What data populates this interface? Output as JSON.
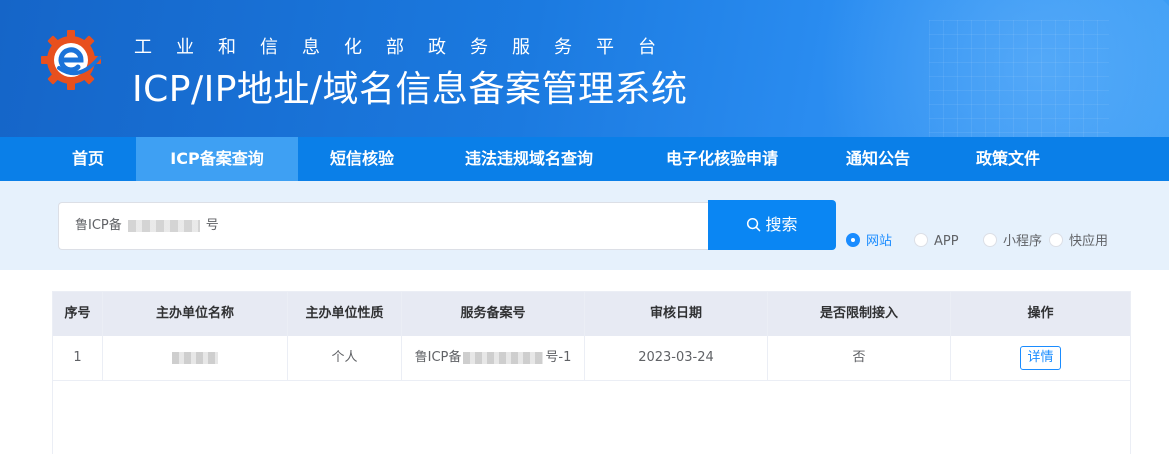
{
  "header": {
    "subtitle": "工业和信息化部政务服务平台",
    "title": "ICP/IP地址/域名信息备案管理系统"
  },
  "nav": {
    "items": [
      {
        "label": "首页"
      },
      {
        "label": "ICP备案查询",
        "active": true
      },
      {
        "label": "短信核验"
      },
      {
        "label": "违法违规域名查询"
      },
      {
        "label": "电子化核验申请"
      },
      {
        "label": "通知公告"
      },
      {
        "label": "政策文件"
      }
    ]
  },
  "search": {
    "value_prefix": "鲁ICP备",
    "value_suffix": "号",
    "button_label": "搜索",
    "options": [
      {
        "label": "网站",
        "checked": true
      },
      {
        "label": "APP",
        "checked": false
      },
      {
        "label": "小程序",
        "checked": false
      },
      {
        "label": "快应用",
        "checked": false
      }
    ]
  },
  "table": {
    "headers": [
      "序号",
      "主办单位名称",
      "主办单位性质",
      "服务备案号",
      "审核日期",
      "是否限制接入",
      "操作"
    ],
    "rows": [
      {
        "index": "1",
        "org_name": "",
        "org_type": "个人",
        "record_prefix": "鲁ICP备",
        "record_suffix": "号-1",
        "date": "2023-03-24",
        "restricted": "否",
        "action": "详情"
      }
    ]
  },
  "colors": {
    "header_bg": "#1b7ae0",
    "nav_bg": "#0a7fe8",
    "nav_active": "#3ea0f3",
    "accent": "#1a8cff",
    "search_band": "#e6f1fc"
  }
}
